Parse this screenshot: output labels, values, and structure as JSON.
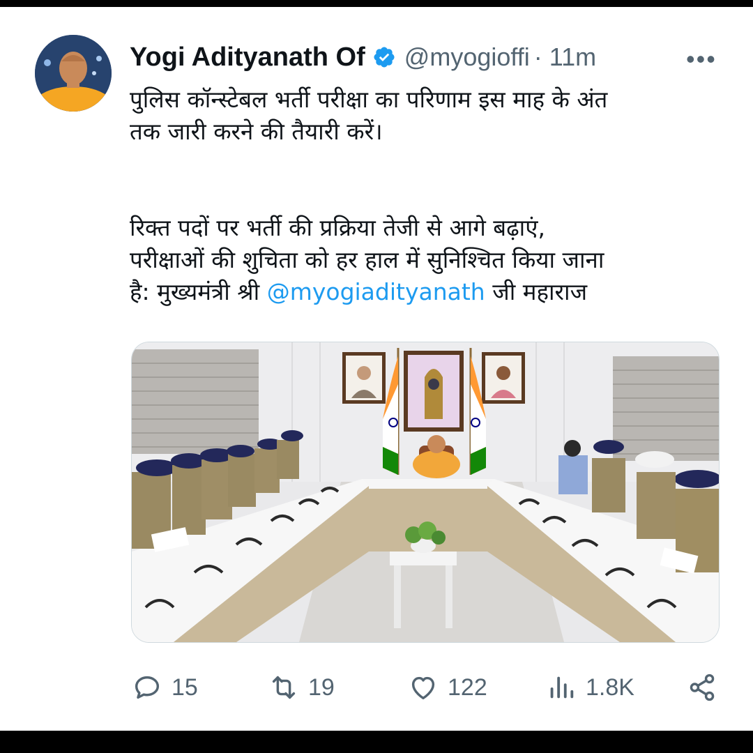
{
  "author": {
    "display_name": "Yogi Adityanath Of",
    "handle": "@myogioffi",
    "time": "· 11m"
  },
  "more_label": "•••",
  "tweet": {
    "line1": "पुलिस कॉन्स्टेबल भर्ती परीक्षा का परिणाम इस माह के अंत",
    "line2": "तक जारी करने की तैयारी करें।",
    "line3": "रिक्त पदों पर भर्ती की प्रक्रिया तेजी से आगे बढ़ाएं,",
    "line4": "परीक्षाओं की शुचिता को हर हाल में सुनिश्चित किया जाना",
    "line5_prefix": "है: मुख्यमंत्री श्री ",
    "mention": "@myogiadityanath",
    "line5_suffix": " जी महाराज"
  },
  "actions": {
    "replies": "15",
    "reposts": "19",
    "likes": "122",
    "views": "1.8K"
  },
  "colors": {
    "accent": "#1d9bf0",
    "text": "#0f1419",
    "muted": "#536471"
  }
}
